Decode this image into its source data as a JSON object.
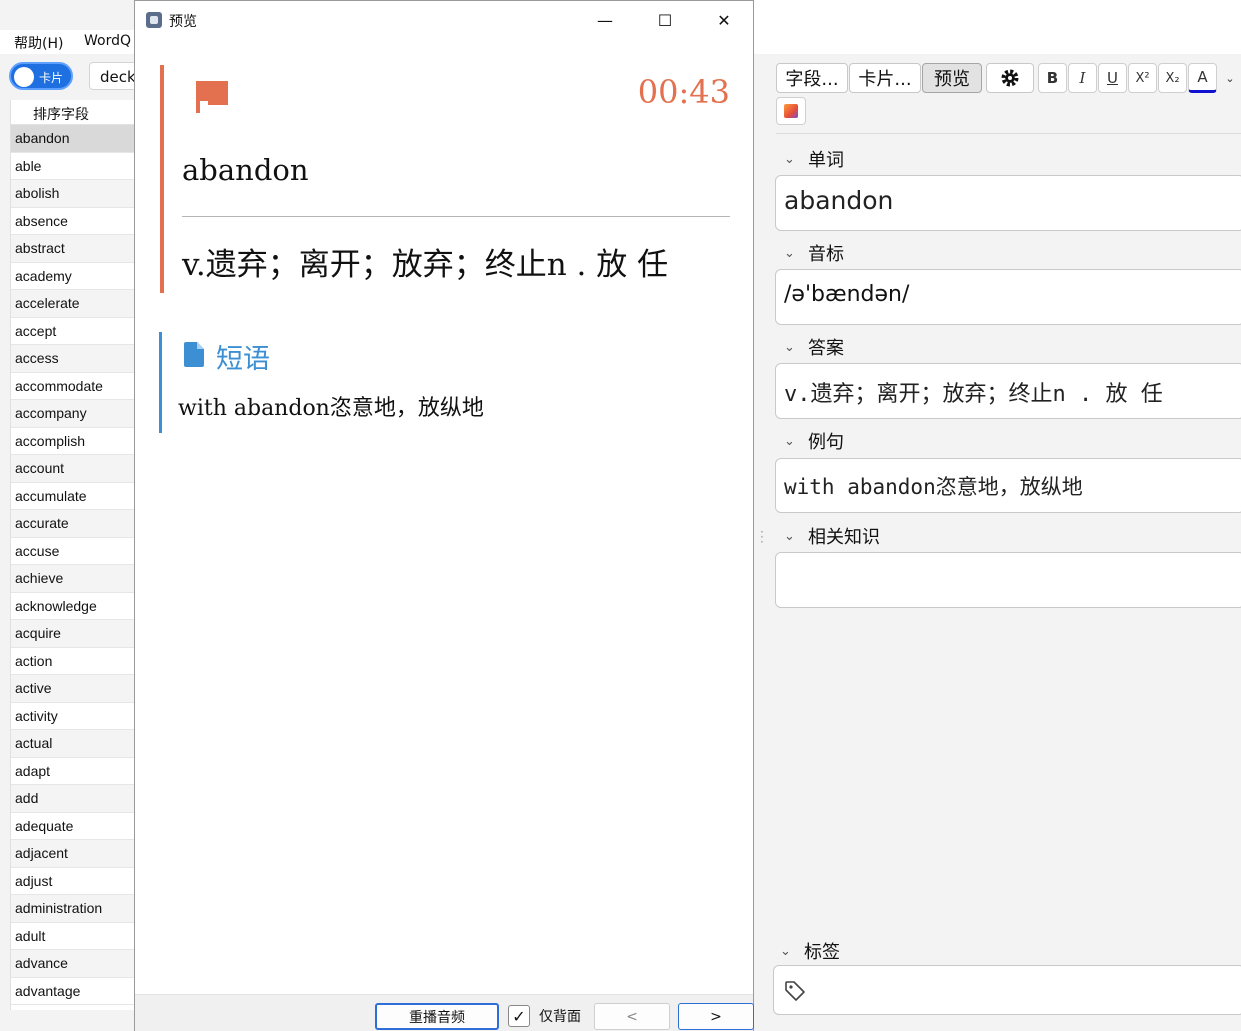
{
  "main_window": {
    "menu": {
      "help": "帮助(H)",
      "wordq": "WordQ"
    },
    "toggle_label": "卡片",
    "deck_value": "deck",
    "list_header": "排序字段",
    "words": [
      "abandon",
      "able",
      "abolish",
      "absence",
      "abstract",
      "academy",
      "accelerate",
      "accept",
      "access",
      "accommodate",
      "accompany",
      "accomplish",
      "account",
      "accumulate",
      "accurate",
      "accuse",
      "achieve",
      "acknowledge",
      "acquire",
      "action",
      "active",
      "activity",
      "actual",
      "adapt",
      "add",
      "adequate",
      "adjacent",
      "adjust",
      "administration",
      "adult",
      "advance",
      "advantage"
    ],
    "selected_index": 0
  },
  "preview": {
    "title": "预览",
    "controls": {
      "minimize": "—",
      "maximize": "☐",
      "close": "✕"
    },
    "timer": "00:43",
    "word": "abandon",
    "answer": "v.遗弃；离开；放弃；终止n . 放 任",
    "phrase_title": "短语",
    "phrase_text": "with abandon恣意地，放纵地",
    "footer": {
      "replay": "重播音频",
      "back_only": "仅背面",
      "prev": "<",
      "next": ">",
      "back_only_checked": true
    }
  },
  "editor": {
    "tabs": [
      {
        "label": "字段..."
      },
      {
        "label": "卡片..."
      },
      {
        "label": "预览",
        "active": true
      }
    ],
    "format_buttons": {
      "bold": "B",
      "italic": "I",
      "underline": "U",
      "superscript": "X²",
      "subscript": "X₂",
      "text_color": "A"
    },
    "fields": [
      {
        "label": "单词",
        "value": "abandon"
      },
      {
        "label": "音标",
        "value": "/ə'bændən/"
      },
      {
        "label": "答案",
        "value": "v.遗弃；离开；放弃；终止n . 放 任"
      },
      {
        "label": "例句",
        "value": "with abandon恣意地，放纵地"
      },
      {
        "label": "相关知识",
        "value": ""
      }
    ],
    "tags_label": "标签",
    "colors": {
      "accent_orange": "#e3714f",
      "accent_blue": "#3d8fd3",
      "text_color_bar": "#1010d0"
    }
  }
}
